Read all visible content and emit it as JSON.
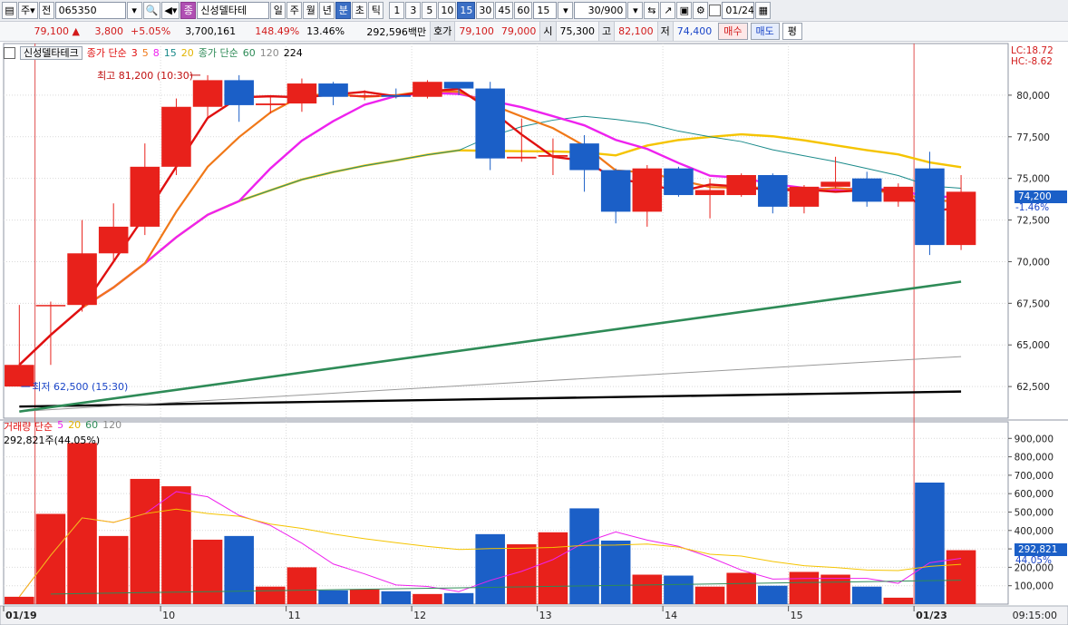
{
  "toolbar": {
    "market": "주",
    "mode": "전",
    "code": "065350",
    "stock_badge": "종",
    "stock_name": "신성델타테",
    "periods": [
      "일",
      "주",
      "월",
      "년",
      "분",
      "초",
      "틱"
    ],
    "active_period": "분",
    "intervals": [
      "1",
      "3",
      "5",
      "10",
      "15",
      "30",
      "45",
      "60"
    ],
    "active_interval": "15",
    "interval_select": "15",
    "count": "30/900",
    "date": "01/24"
  },
  "quote": {
    "price": "79,100 ▲",
    "change": "3,800",
    "change_pct": "+5.05%",
    "volume": "3,700,161",
    "vol_ratio": "148.49%",
    "turnover": "13.46%",
    "amount": "292,596백만",
    "bid_label": "호가",
    "bid": "79,100",
    "ask": "79,000",
    "open_label": "시",
    "open": "75,300",
    "high_label": "고",
    "high": "82,100",
    "low_label": "저",
    "low": "74,400",
    "buy_btn": "매수",
    "sell_btn": "매도",
    "eval_btn": "평"
  },
  "legend": {
    "name": "신성델타테크",
    "ma_label": "종가 단순",
    "ma_periods": [
      "3",
      "5",
      "8",
      "15",
      "20"
    ],
    "ma2_label": "종가 단순",
    "ma2_periods": [
      "60",
      "120",
      "224"
    ]
  },
  "colors": {
    "up": "#e8211b",
    "down": "#1b5fc7",
    "ma3": "#e01010",
    "ma5": "#f07818",
    "ma8": "#ee22ee",
    "ma15": "#1a8a8a",
    "ma20": "#f5c400",
    "ma60": "#2e8b57",
    "ma120": "#9a9a9a",
    "ma224": "#000000"
  },
  "price_panel": {
    "lc": "LC:18.72",
    "hc": "HC:-8.62",
    "current": "74,200",
    "current_pct": "-1.46%",
    "high_note": "최고 81,200 (10:30)",
    "low_note": "최저 62,500 (15:30)"
  },
  "volume_panel": {
    "label": "거래량 단순",
    "periods": [
      "5",
      "20",
      "60",
      "120"
    ],
    "summary": "292,821주(44.05%)",
    "current": "292,821",
    "current_pct": "44.05%"
  },
  "time_axis": {
    "labels": [
      "01/19",
      "10",
      "11",
      "12",
      "13",
      "14",
      "15",
      "01/23"
    ],
    "clock": "09:15:00"
  },
  "chart_data": {
    "type": "candlestick",
    "price_axis": {
      "ticks": [
        62500,
        65000,
        67500,
        70000,
        72500,
        75000,
        77500,
        80000
      ],
      "range": [
        60600,
        83100
      ]
    },
    "volume_axis": {
      "ticks": [
        100000,
        200000,
        300000,
        400000,
        500000,
        600000,
        700000,
        800000,
        900000
      ],
      "range": [
        0,
        990000
      ]
    },
    "candles": [
      {
        "o": 62500,
        "c": 63800,
        "h": 67400,
        "l": 62500,
        "v": 40000
      },
      {
        "o": 67400,
        "c": 67400,
        "h": 67600,
        "l": 63800,
        "v": 490000
      },
      {
        "o": 67400,
        "c": 70500,
        "h": 72500,
        "l": 67000,
        "v": 875000
      },
      {
        "o": 70500,
        "c": 72100,
        "h": 73500,
        "l": 70000,
        "v": 370000
      },
      {
        "o": 72100,
        "c": 75700,
        "h": 77100,
        "l": 71600,
        "v": 680000
      },
      {
        "o": 75700,
        "c": 79300,
        "h": 79800,
        "l": 75200,
        "v": 640000
      },
      {
        "o": 79300,
        "c": 80900,
        "h": 81200,
        "l": 78700,
        "v": 350000
      },
      {
        "o": 80900,
        "c": 79400,
        "h": 81200,
        "l": 78400,
        "v": 370000
      },
      {
        "o": 79400,
        "c": 79500,
        "h": 79900,
        "l": 78900,
        "v": 95000
      },
      {
        "o": 79500,
        "c": 80700,
        "h": 81000,
        "l": 79000,
        "v": 200000
      },
      {
        "o": 80700,
        "c": 79900,
        "h": 80800,
        "l": 79400,
        "v": 75000
      },
      {
        "o": 79900,
        "c": 80000,
        "h": 80300,
        "l": 79700,
        "v": 80000
      },
      {
        "o": 80000,
        "c": 79900,
        "h": 80400,
        "l": 79800,
        "v": 70000
      },
      {
        "o": 79900,
        "c": 80800,
        "h": 80900,
        "l": 79800,
        "v": 55000
      },
      {
        "o": 80800,
        "c": 80400,
        "h": 80700,
        "l": 80000,
        "v": 60000
      },
      {
        "o": 80400,
        "c": 76200,
        "h": 80800,
        "l": 75500,
        "v": 380000
      },
      {
        "o": 76200,
        "c": 76300,
        "h": 78600,
        "l": 76000,
        "v": 325000
      },
      {
        "o": 76300,
        "c": 76400,
        "h": 77400,
        "l": 75200,
        "v": 390000
      },
      {
        "o": 77100,
        "c": 75500,
        "h": 77600,
        "l": 74200,
        "v": 520000
      },
      {
        "o": 75500,
        "c": 73000,
        "h": 75600,
        "l": 72300,
        "v": 345000
      },
      {
        "o": 73000,
        "c": 75600,
        "h": 75800,
        "l": 72100,
        "v": 160000
      },
      {
        "o": 75600,
        "c": 74000,
        "h": 75700,
        "l": 73900,
        "v": 155000
      },
      {
        "o": 74000,
        "c": 74300,
        "h": 75000,
        "l": 72600,
        "v": 95000
      },
      {
        "o": 74000,
        "c": 75200,
        "h": 75300,
        "l": 73900,
        "v": 170000
      },
      {
        "o": 75200,
        "c": 73300,
        "h": 75300,
        "l": 72900,
        "v": 100000
      },
      {
        "o": 73300,
        "c": 74500,
        "h": 74600,
        "l": 72900,
        "v": 175000
      },
      {
        "o": 74500,
        "c": 74800,
        "h": 76300,
        "l": 74400,
        "v": 160000
      },
      {
        "o": 75000,
        "c": 73600,
        "h": 75400,
        "l": 73300,
        "v": 95000
      },
      {
        "o": 73600,
        "c": 74500,
        "h": 74700,
        "l": 73300,
        "v": 35000
      },
      {
        "o": 75600,
        "c": 71000,
        "h": 76600,
        "l": 70400,
        "v": 660000
      },
      {
        "o": 71000,
        "c": 74200,
        "h": 75200,
        "l": 70700,
        "v": 292821
      }
    ],
    "ma60": [
      61000,
      68800
    ],
    "ma120": [
      61000,
      64300
    ],
    "ma224": [
      61300,
      62200
    ],
    "vol_ma20_level": 130000,
    "vol_ma60_level": 55000
  }
}
